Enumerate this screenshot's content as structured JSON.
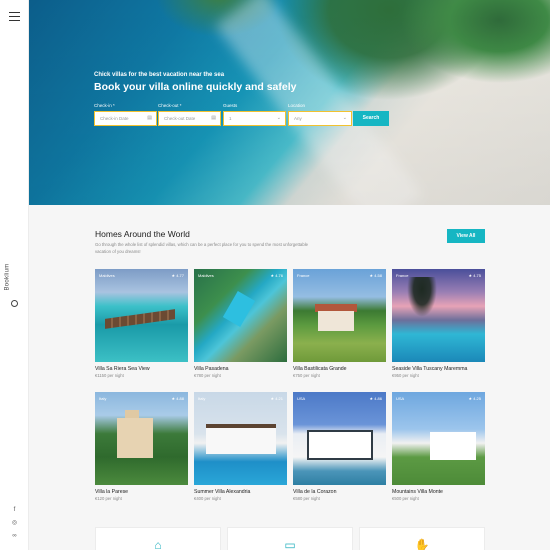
{
  "rail": {
    "brand_name": "Booklium",
    "social": [
      "f",
      "◎",
      "∞"
    ]
  },
  "hero": {
    "subtitle": "Chick villas for the best vacation near the sea",
    "title": "Book your villa online quickly and safely",
    "form": {
      "checkin_label": "Check-in *",
      "checkin_placeholder": "Check-in Date",
      "checkout_label": "Check-out *",
      "checkout_placeholder": "Check-out Date",
      "guests_label": "Guests",
      "guests_value": "1",
      "location_label": "Location",
      "location_value": "Any",
      "search_label": "Search"
    }
  },
  "homes": {
    "title": "Homes Around the World",
    "description": "Go through the whole list of splendid villas, which can be a perfect place for you to spend the most unforgettable vacation of you dreams!",
    "view_all": "View All",
    "cards": [
      {
        "location": "Maldives",
        "rating": "★ 4.77",
        "name": "Villa Sa Riera Sea View",
        "price": "€1150 per night"
      },
      {
        "location": "Maldives",
        "rating": "★ 4.76",
        "name": "Villa Pasadena",
        "price": "€780 per night"
      },
      {
        "location": "France",
        "rating": "★ 4.58",
        "name": "Villa Bastilicata Grande",
        "price": "€750 per night"
      },
      {
        "location": "France",
        "rating": "★ 4.75",
        "name": "Seaside Villa Tuscany Maremma",
        "price": "€950 per night"
      },
      {
        "location": "Italy",
        "rating": "★ 4.88",
        "name": "Villa la Parese",
        "price": "€120 per night"
      },
      {
        "location": "Italy",
        "rating": "★ 4.21",
        "name": "Summer Villa Alexandria",
        "price": "€400 per night"
      },
      {
        "location": "USA",
        "rating": "★ 4.86",
        "name": "Villa de la Corazon",
        "price": "€580 per night"
      },
      {
        "location": "USA",
        "rating": "★ 4.25",
        "name": "Mountains Villa Monte",
        "price": "€500 per night"
      }
    ]
  },
  "features": [
    {
      "icon": "house-icon"
    },
    {
      "icon": "document-icon"
    },
    {
      "icon": "hand-icon"
    }
  ],
  "colors": {
    "accent": "#16b6c3",
    "field_border": "#f2c230"
  }
}
